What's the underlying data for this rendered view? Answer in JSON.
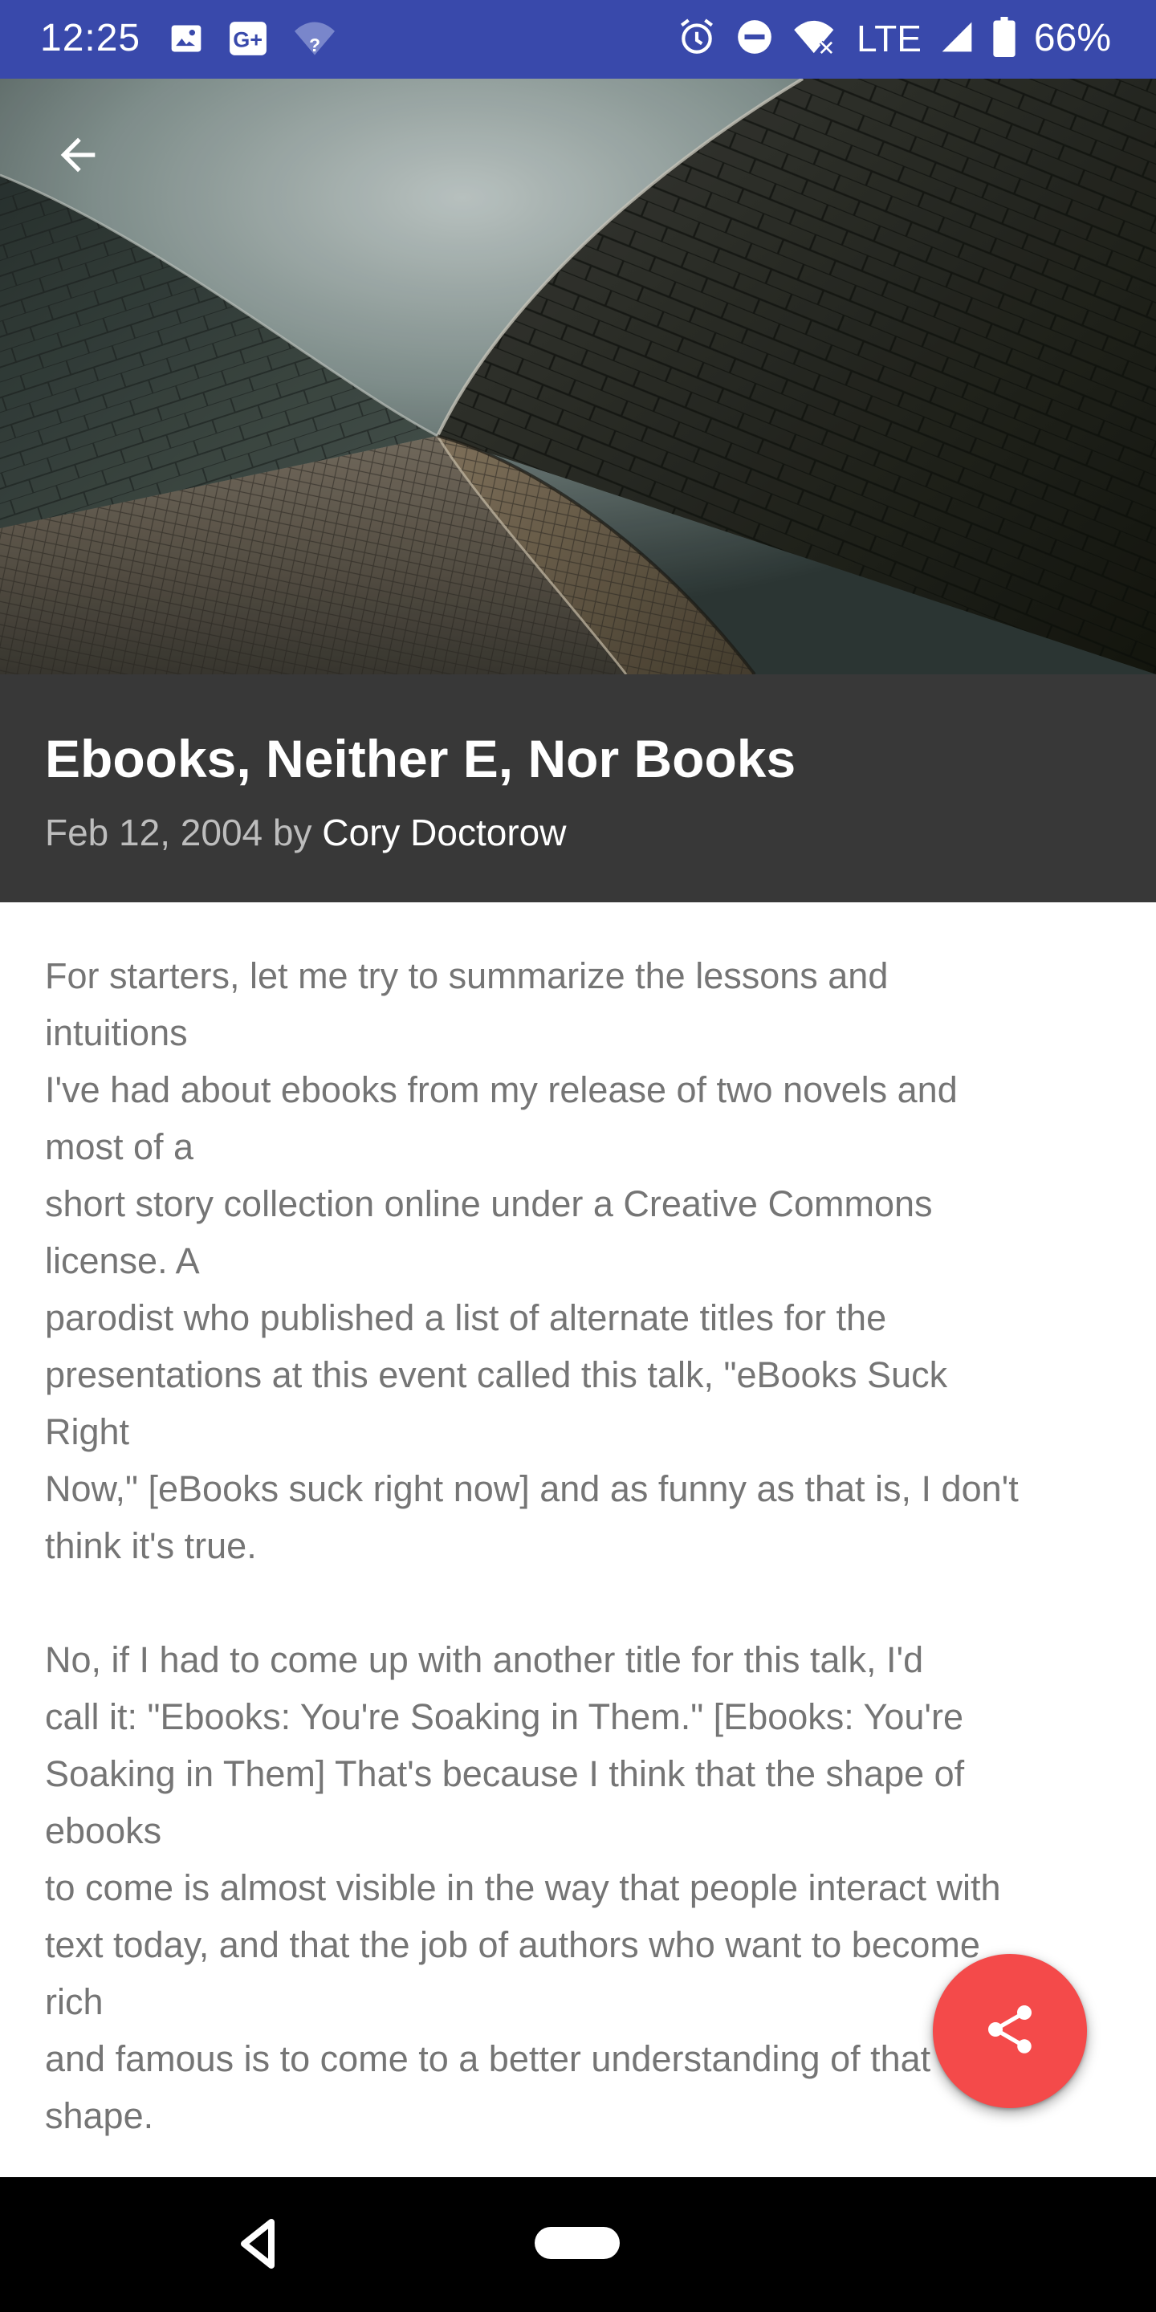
{
  "status_bar": {
    "time": "12:25",
    "network": "LTE",
    "battery": "66%",
    "icons": [
      "image-icon",
      "google-plus-icon",
      "wifi-unknown-icon",
      "alarm-icon",
      "do-not-disturb-icon",
      "wifi-calling-icon",
      "cell-signal-icon",
      "battery-icon"
    ]
  },
  "hero": {
    "back_icon": "arrow-back-icon"
  },
  "article": {
    "title": "Ebooks, Neither E, Nor Books",
    "date": "Feb 12, 2004",
    "by": " by ",
    "author": "Cory Doctorow",
    "paragraph1": [
      "For starters, let me try to summarize the lessons and",
      "intuitions",
      "I've had about ebooks from my release of two novels and",
      "most of a",
      "short story collection online under a Creative Commons",
      "license. A",
      "parodist who published a list of alternate titles for the",
      "presentations at this event called this talk, \"eBooks Suck",
      "Right",
      "Now,\" [eBooks suck right now] and as funny as that is, I don't",
      "think it's true."
    ],
    "paragraph2": [
      "No, if I had to come up with another title for this talk, I'd",
      "call it: \"Ebooks: You're Soaking in Them.\" [Ebooks: You're",
      "Soaking in Them] That's because I think that the shape of",
      "ebooks",
      "to come is almost visible in the way that people interact with",
      "text today, and that the job of authors who want to become",
      "rich",
      "and famous is to come to a better understanding of that",
      "shape."
    ]
  },
  "fab": {
    "icon": "share-icon",
    "color": "#f44a4a"
  },
  "nav_bar": {
    "back_icon": "nav-back-icon",
    "home_icon": "nav-home-pill"
  },
  "colors": {
    "status_bar": "#3949ab",
    "title_block": "#383838",
    "body_text": "#757575"
  }
}
